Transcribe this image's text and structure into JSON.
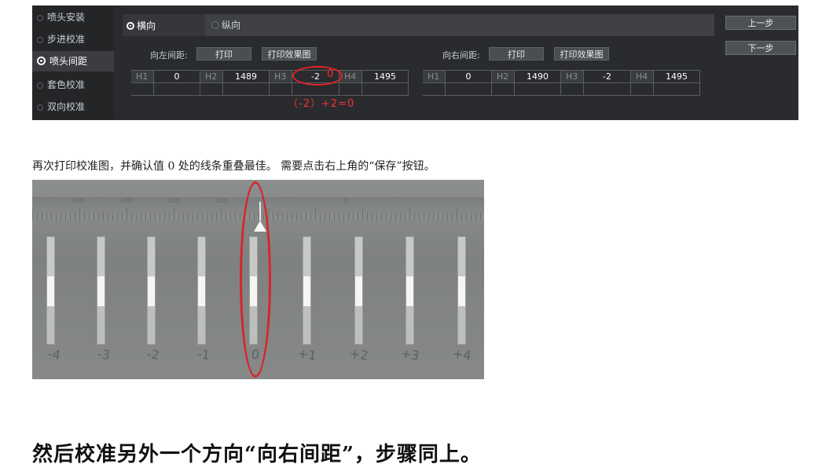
{
  "sidebar": {
    "items": [
      {
        "label": "喷头安装",
        "active": false
      },
      {
        "label": "步进校准",
        "active": false
      },
      {
        "label": "喷头间距",
        "active": true
      },
      {
        "label": "套色校准",
        "active": false
      },
      {
        "label": "双向校准",
        "active": false
      }
    ]
  },
  "orientation": {
    "horizontal": "横向",
    "vertical": "纵向",
    "selected": "横向"
  },
  "nav": {
    "prev": "上一步",
    "next": "下一步"
  },
  "left_spacing": {
    "label": "向左间距:",
    "print_button": "打印",
    "print_effect_button": "打印效果图",
    "cells": [
      {
        "key": "H1",
        "value": "0"
      },
      {
        "key": "H2",
        "value": "1489"
      },
      {
        "key": "H3",
        "value": "-2"
      },
      {
        "key": "H4",
        "value": "1495"
      }
    ]
  },
  "right_spacing": {
    "label": "向右间距:",
    "print_button": "打印",
    "print_effect_button": "打印效果图",
    "cells": [
      {
        "key": "H1",
        "value": "0"
      },
      {
        "key": "H2",
        "value": "1490"
      },
      {
        "key": "H3",
        "value": "-2"
      },
      {
        "key": "H4",
        "value": "1495"
      }
    ]
  },
  "annotation": {
    "corrected_value": "0",
    "formula": "（-2）+2=0"
  },
  "instruction": "再次打印校准图，并确认值 0 处的线条重叠最佳。 需要点击右上角的“保存”按钮。",
  "photo": {
    "ruler_numbers": [
      "-400",
      "-300",
      "-200",
      "-100",
      "0"
    ],
    "bar_labels": [
      "-4",
      "-3",
      "-2",
      "-1",
      "0",
      "+1",
      "+2",
      "+3",
      "+4"
    ],
    "selected_label": "0"
  },
  "heading": "然后校准另外一个方向“向右间距”，步骤同上。",
  "colors": {
    "panel_bg": "#2a2b2e",
    "annotation_red": "#e0232a"
  }
}
